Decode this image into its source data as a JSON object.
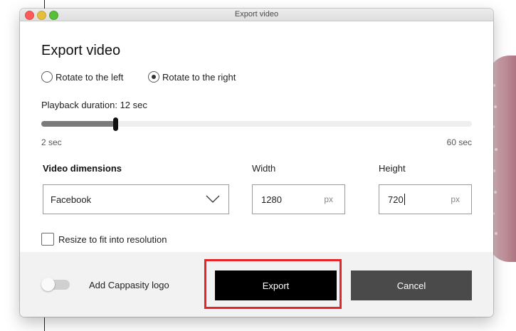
{
  "window": {
    "title": "Export video"
  },
  "dialog": {
    "heading": "Export video",
    "rotation": {
      "options": [
        {
          "label": "Rotate to the left",
          "selected": false
        },
        {
          "label": "Rotate to the right",
          "selected": true
        }
      ]
    },
    "duration": {
      "label": "Playback duration: 12 sec",
      "min_label": "2 sec",
      "max_label": "60 sec",
      "min": 2,
      "max": 60,
      "value": 12
    },
    "dimensions": {
      "label": "Video dimensions",
      "preset": "Facebook",
      "width_label": "Width",
      "width_value": "1280",
      "height_label": "Height",
      "height_value": "720",
      "unit": "px"
    },
    "resize": {
      "label": "Resize to fit into resolution",
      "checked": false
    }
  },
  "footer": {
    "logo_toggle": {
      "label": "Add Cappasity logo",
      "on": false
    },
    "export_label": "Export",
    "cancel_label": "Cancel"
  },
  "colors": {
    "highlight": "#e8232a",
    "export_button": "#000000",
    "cancel_button": "#4a4a4a",
    "slider_fill": "#7a7a7a"
  },
  "icons": {
    "dropdown": "chevron-down-icon"
  }
}
